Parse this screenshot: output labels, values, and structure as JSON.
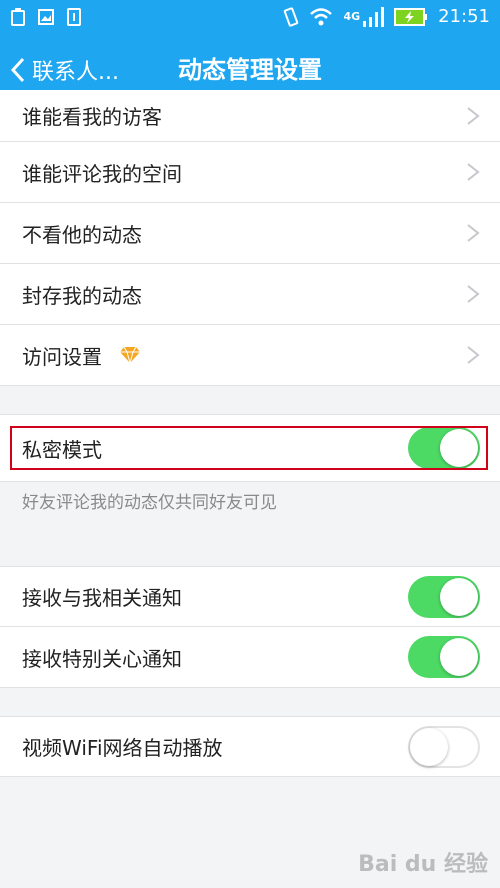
{
  "status_bar": {
    "time": "21:51",
    "network": "4G",
    "icons": [
      "battery-saver-icon",
      "image-icon",
      "sim-icon",
      "vibrate-icon",
      "wifi-icon",
      "signal-icon",
      "battery-charging-icon"
    ]
  },
  "nav": {
    "back_label": "联系人...",
    "title": "动态管理设置"
  },
  "settings": {
    "visitors": "谁能看我的访客",
    "comment_space": "谁能评论我的空间",
    "hide_feeds": "不看他的动态",
    "archive_feeds": "封存我的动态",
    "access_settings": "访问设置",
    "private_mode": "私密模式",
    "private_mode_note": "好友评论我的动态仅共同好友可见",
    "related_notify": "接收与我相关通知",
    "special_notify": "接收特别关心通知",
    "wifi_autoplay": "视频WiFi网络自动播放"
  },
  "toggles": {
    "private_mode": true,
    "related_notify": true,
    "special_notify": true,
    "wifi_autoplay": false
  },
  "colors": {
    "primary": "#1ea6f0",
    "toggle_on": "#4cd964",
    "highlight": "#d0021b",
    "diamond": "#f5a623"
  },
  "watermark": "Bai du 经验"
}
